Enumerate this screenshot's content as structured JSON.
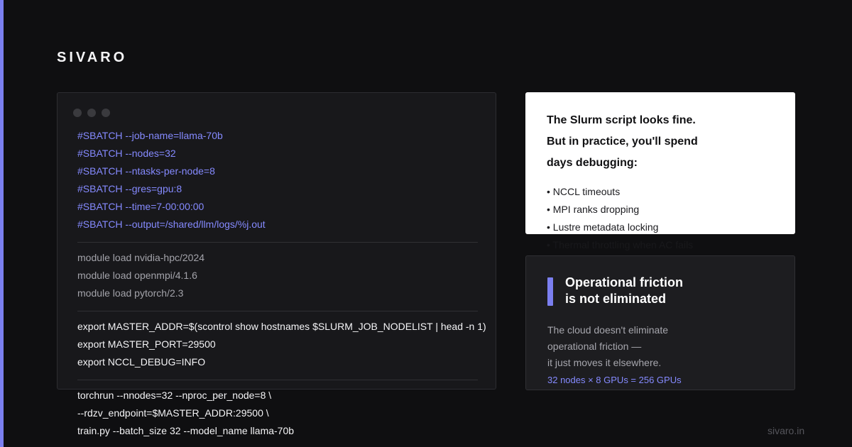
{
  "brand": {
    "name": "SIVARO"
  },
  "terminal": {
    "window_control_icons": [
      "red-window-dot-icon",
      "yellow-window-dot-icon",
      "green-window-dot-icon"
    ],
    "sbatch_lines": [
      "#SBATCH --job-name=llama-70b",
      "#SBATCH --nodes=32",
      "#SBATCH --ntasks-per-node=8",
      "#SBATCH --gres=gpu:8",
      "#SBATCH --time=7-00:00:00",
      "#SBATCH --output=/shared/llm/logs/%j.out"
    ],
    "module_lines": [
      "module load nvidia-hpc/2024",
      "module load openmpi/4.1.6",
      "module load pytorch/2.3"
    ],
    "export_lines": [
      "export MASTER_ADDR=$(scontrol show hostnames $SLURM_JOB_NODELIST | head -n 1)",
      "export MASTER_PORT=29500",
      "export NCCL_DEBUG=INFO"
    ],
    "torchrun_lines": [
      "torchrun --nnodes=32 --nproc_per_node=8 \\",
      "--rdzv_endpoint=$MASTER_ADDR:29500 \\",
      "train.py --batch_size 32 --model_name llama-70b"
    ]
  },
  "callout": {
    "heading_lines": [
      "The Slurm script looks fine.",
      "But in practice, you'll spend",
      "days debugging:"
    ],
    "bullets": [
      "• NCCL timeouts",
      "• MPI ranks dropping",
      "• Lustre metadata locking",
      "• Thermal throttling when AC fails"
    ]
  },
  "friction": {
    "title_lines": [
      "Operational friction",
      "is not eliminated"
    ],
    "description_lines": [
      "The cloud doesn't eliminate",
      "operational friction —",
      "it just moves it elsewhere."
    ],
    "gpu_summary": "32 nodes × 8 GPUs = 256 GPUs"
  },
  "footer": {
    "domain": "sivaro.in"
  },
  "colors": {
    "background": "#0f0f11",
    "accent": "#7b7ff0",
    "terminal_background": "#18181b",
    "sbatch_text": "#858aff",
    "module_text": "#a3a3aa",
    "white_text": "#f4f4f6"
  }
}
